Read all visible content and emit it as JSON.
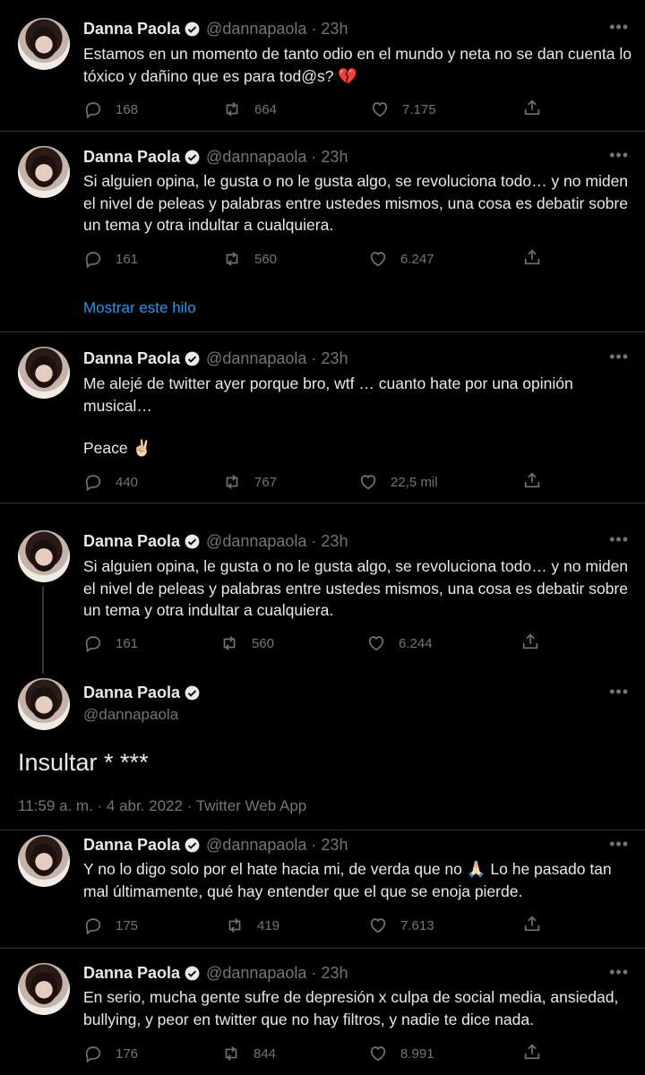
{
  "author": {
    "name": "Danna Paola",
    "handle": "@dannapaola",
    "time": "23h"
  },
  "tweets": [
    {
      "text": "Estamos en un momento de tanto odio en el mundo y neta no se dan cuenta lo tóxico y dañino que es para tod@s? 💔",
      "replies": "168",
      "retweets": "664",
      "likes": "7.175"
    },
    {
      "text": "Si alguien opina, le gusta o no le gusta algo, se revoluciona todo… y no miden el nivel de peleas y palabras entre ustedes mismos, una cosa es debatir sobre un tema y otra indultar a cualquiera.",
      "replies": "161",
      "retweets": "560",
      "likes": "6.247",
      "thread_link": "Mostrar este hilo"
    },
    {
      "text_line1": "Me alejé de twitter ayer porque bro, wtf … cuanto hate por una opinión musical…",
      "text_line2": "Peace ✌🏻",
      "replies": "440",
      "retweets": "767",
      "likes": "22,5 mil"
    },
    {
      "text": "Si alguien opina, le gusta o no le gusta algo, se revoluciona todo… y no miden el nivel de peleas y palabras entre ustedes mismos, una cosa es debatir sobre un tema y otra indultar a cualquiera.",
      "replies": "161",
      "retweets": "560",
      "likes": "6.244"
    },
    {
      "big_text": "Insultar * ***",
      "meta": "11:59 a. m. · 4 abr. 2022 · Twitter Web App"
    },
    {
      "text": "Y no lo digo solo por el hate hacia mi, de verda que no 🙏🏻 Lo he pasado tan mal últimamente, qué hay entender que el que se enoja pierde.",
      "replies": "175",
      "retweets": "419",
      "likes": "7.613"
    },
    {
      "text": "En serio, mucha gente sufre de depresión x culpa de social media, ansiedad, bullying, y peor en twitter que no hay filtros, y nadie te dice nada.",
      "replies": "176",
      "retweets": "844",
      "likes": "8.991"
    }
  ],
  "icons": {
    "reply": "reply-icon",
    "retweet": "retweet-icon",
    "like": "heart-icon",
    "share": "share-icon",
    "verified": "verified-badge-icon",
    "more": "more-icon"
  },
  "colors": {
    "background": "#000000",
    "text": "#e7e9ea",
    "muted": "#71767b",
    "link": "#1d9bf0",
    "divider": "#2f3336"
  }
}
